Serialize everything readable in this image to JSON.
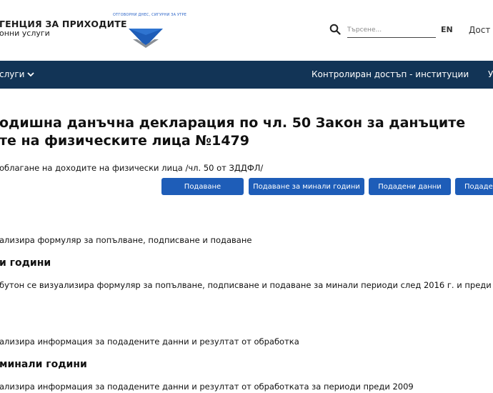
{
  "header": {
    "agency_name": "ГЕНЦИЯ ЗА ПРИХОДИТЕ",
    "agency_sub": "онни услуги",
    "logo_caption": "ОТГОВОРНИ ДНЕС, СИГУРНИ ЗА УТРЕ",
    "search_placeholder": "Търсене...",
    "lang": "EN",
    "access": "Дост"
  },
  "nav": {
    "left": "слуги",
    "right": "Контролиран достъп - институции",
    "cut": "У"
  },
  "page": {
    "title_line1": "одишна данъчна декларация по чл. 50 Закон за данъците",
    "title_line2": "те на физическите лица №1479",
    "subtitle": "облагане на доходите на физически лица /чл. 50 от ЗДДФЛ/"
  },
  "buttons": {
    "submit": "Подаване",
    "past_years": "Подаване за минали години",
    "submitted": "Подадени данни",
    "cut": "Подаден"
  },
  "sections": {
    "s1_text": "ализира формуляр за попълване, подписване и подаване",
    "s2_head": "и години",
    "s2_text": "бутон се визуализира формуляр за попълване, подписване и подаване за минали периоди след 2016 г. и преди те",
    "s3_text": "ализира информация за подадените данни и резултат от обработка",
    "s4_head": "минали години",
    "s4_text": "ализира информация за подадените данни и резултат от обработката за периоди преди 2009"
  },
  "colors": {
    "navbar": "#123456",
    "button": "#1e5db8",
    "logo_blue": "#1e5db8",
    "logo_gray": "#8a8f95"
  },
  "icons": {
    "search": "search-icon",
    "chevron": "chevron-down-icon",
    "logo": "nap-logo-icon"
  }
}
